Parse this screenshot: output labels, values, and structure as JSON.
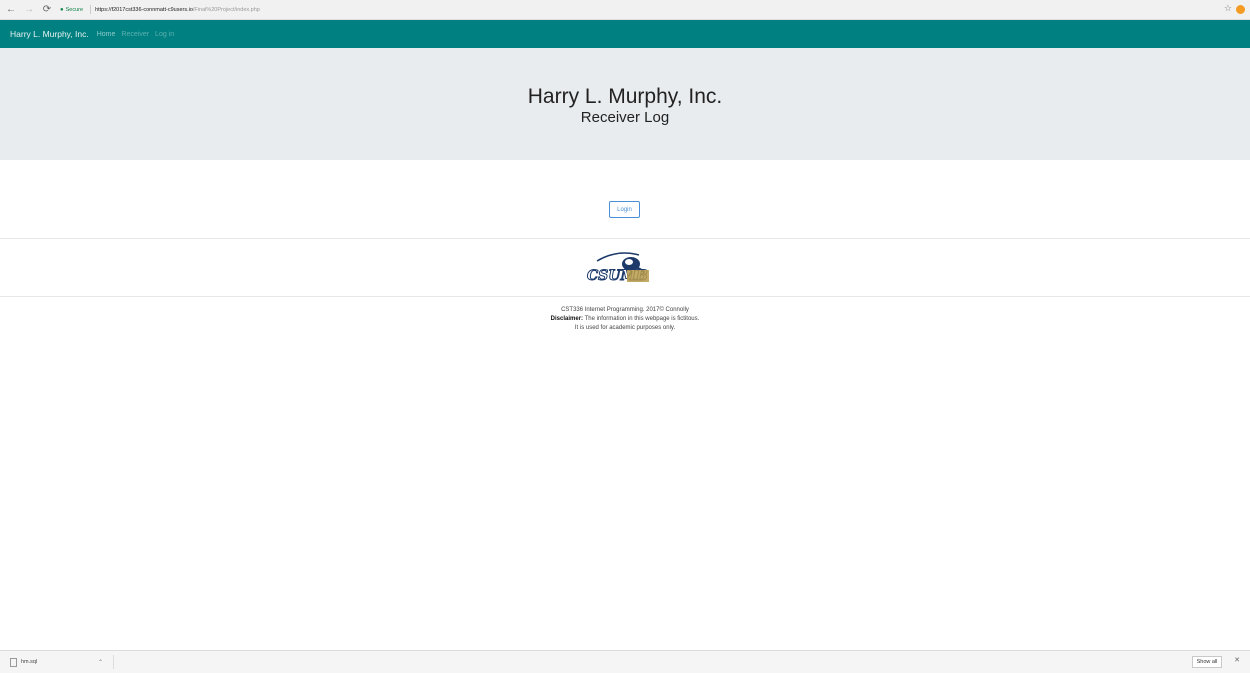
{
  "browser": {
    "secure_label": "Secure",
    "url_host": "https://f2017cst336-connmatt-c9users.io",
    "url_path": "/Final%20Project/index.php"
  },
  "nav": {
    "brand": "Harry L. Murphy, Inc.",
    "links": [
      "Home",
      "Receiver",
      "Log in"
    ]
  },
  "jumbotron": {
    "title": "Harry L. Murphy, Inc.",
    "subtitle": "Receiver Log"
  },
  "login_button": "Login",
  "logo_text": "CSUMB",
  "footer": {
    "line1": "CST336 Internet Programming. 2017© Connolly",
    "disclaimer_label": "Disclaimer:",
    "disclaimer_text": " The information in this webpage is fictitous.",
    "line3": "It is used for academic purposes only."
  },
  "download_shelf": {
    "file_name": "hm.sql",
    "show_all": "Show all"
  },
  "icons": [
    "back-icon",
    "forward-icon",
    "reload-icon",
    "lock-icon",
    "star-icon",
    "extension-icon",
    "file-icon",
    "chevron-up-icon",
    "close-icon"
  ],
  "colors": {
    "nav_bg": "#008080",
    "jumbotron_bg": "#e9ecef",
    "button_border": "#4a90d9"
  }
}
